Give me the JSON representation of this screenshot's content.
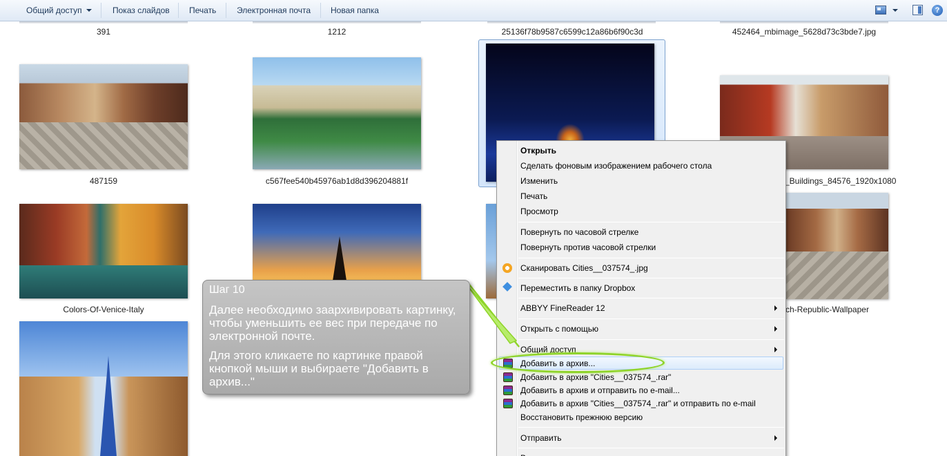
{
  "toolbar": {
    "share_label": "Общий доступ",
    "slideshow_label": "Показ слайдов",
    "print_label": "Печать",
    "email_label": "Электронная почта",
    "new_folder_label": "Новая папка",
    "help_glyph": "?"
  },
  "files": {
    "top_row": [
      "391",
      "1212",
      "25136f78b9587c6599c12a86b6f90c3d",
      "452464_mbimage_5628d73c3bde7.jpg"
    ],
    "row1": [
      "487159",
      "c567fee540b45976ab1d8d396204881f",
      "",
      "_Buildings_84576_1920x1080"
    ],
    "row2": [
      "Colors-Of-Venice-Italy",
      "",
      "",
      "ch-Republic-Wallpaper"
    ]
  },
  "context_menu": {
    "open": "Открыть",
    "set_wallpaper": "Сделать фоновым изображением рабочего стола",
    "edit": "Изменить",
    "print": "Печать",
    "preview": "Просмотр",
    "rotate_cw": "Повернуть по часовой стрелке",
    "rotate_ccw": "Повернуть против часовой стрелки",
    "scan": "Сканировать Cities__037574_.jpg",
    "move_dropbox": "Переместить в папку Dropbox",
    "abbyy": "ABBYY FineReader 12",
    "open_with": "Открыть с помощью",
    "share": "Общий доступ",
    "add_archive": "Добавить в архив...",
    "add_archive_rar": "Добавить в архив \"Cities__037574_.rar\"",
    "add_archive_email": "Добавить в архив и отправить по e-mail...",
    "add_archive_rar_email": "Добавить в архив \"Cities__037574_.rar\" и отправить по e-mail",
    "restore": "Восстановить прежнюю версию",
    "send_to": "Отправить",
    "partial": "В"
  },
  "callout": {
    "title": "Шаг 10",
    "paragraph1": "Далее необходимо заархивировать картинку, чтобы уменьшить ее вес при передаче по электронной почте.",
    "paragraph2": "Для этого кликаете по картинке правой кнопкой мыши и выбираете \"Добавить в архив...\""
  },
  "colors": {
    "highlight_ring": "#8fd42a",
    "callout_bg": "#b4b4b4",
    "menu_bg": "#f0f0f0"
  }
}
